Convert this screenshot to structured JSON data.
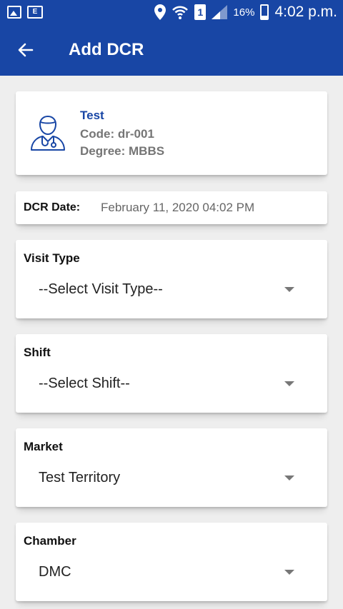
{
  "status_bar": {
    "e_icon_text": "E",
    "sim_number": "1",
    "battery_percent": "16%",
    "time": "4:02 p.m."
  },
  "app_bar": {
    "title": "Add DCR"
  },
  "doctor": {
    "name": "Test",
    "code": "Code: dr-001",
    "degree": "Degree: MBBS"
  },
  "dcr_date": {
    "label": "DCR Date:",
    "value": "February 11, 2020 04:02 PM"
  },
  "visit_type": {
    "label": "Visit Type",
    "value": "--Select Visit Type--"
  },
  "shift": {
    "label": "Shift",
    "value": "--Select Shift--"
  },
  "market": {
    "label": "Market",
    "value": "Test Territory"
  },
  "chamber": {
    "label": "Chamber",
    "value": "DMC"
  },
  "colors": {
    "primary": "#1846a5",
    "background": "#eeeeee",
    "label_gray": "#757575"
  }
}
